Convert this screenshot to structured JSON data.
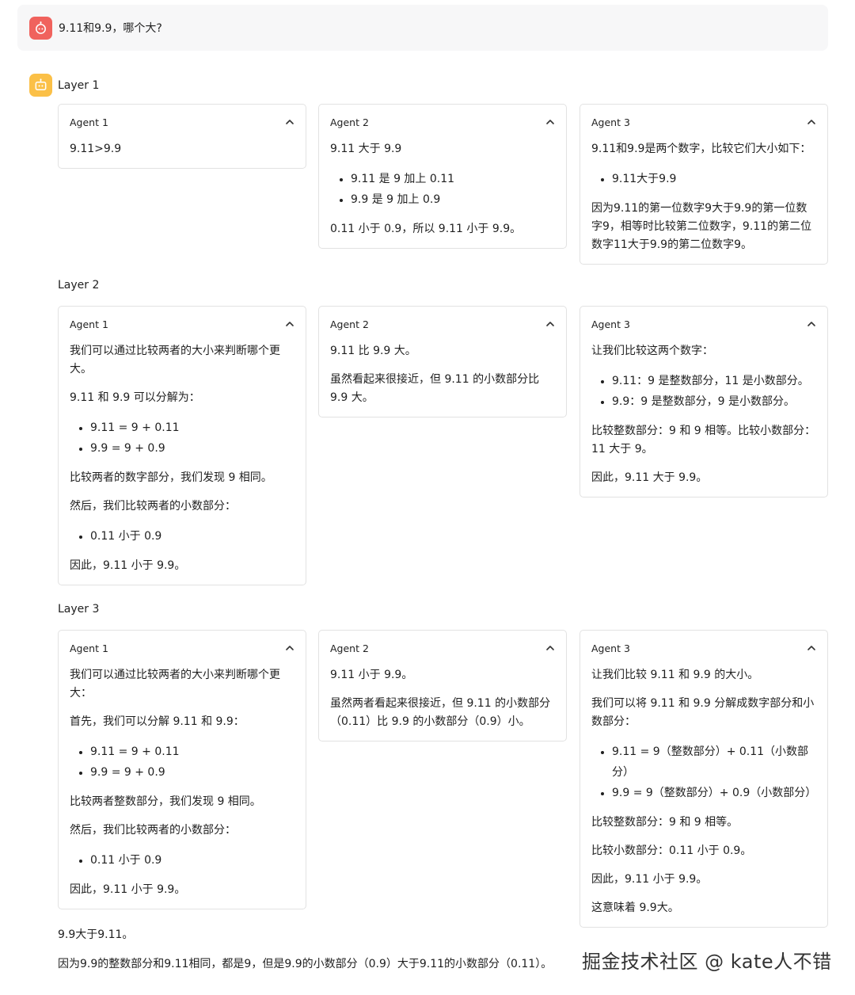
{
  "user_message": "9.11和9.9，哪个大?",
  "layers": [
    {
      "label": "Layer 1",
      "agents": [
        {
          "title": "Agent 1",
          "blocks": [
            {
              "type": "p",
              "text": "9.11>9.9"
            }
          ]
        },
        {
          "title": "Agent 2",
          "blocks": [
            {
              "type": "p",
              "text": "9.11 大于 9.9"
            },
            {
              "type": "ul",
              "items": [
                "9.11 是 9 加上 0.11",
                "9.9 是 9 加上 0.9"
              ]
            },
            {
              "type": "p",
              "text": "0.11 小于 0.9，所以 9.11 小于 9.9。"
            }
          ]
        },
        {
          "title": "Agent 3",
          "blocks": [
            {
              "type": "p",
              "text": "9.11和9.9是两个数字，比较它们大小如下："
            },
            {
              "type": "ul",
              "items": [
                "9.11大于9.9"
              ]
            },
            {
              "type": "p",
              "text": "因为9.11的第一位数字9大于9.9的第一位数字9，相等时比较第二位数字，9.11的第二位数字11大于9.9的第二位数字9。"
            }
          ]
        }
      ]
    },
    {
      "label": "Layer 2",
      "agents": [
        {
          "title": "Agent 1",
          "blocks": [
            {
              "type": "p",
              "text": "我们可以通过比较两者的大小来判断哪个更大。"
            },
            {
              "type": "p",
              "text": "9.11 和 9.9 可以分解为："
            },
            {
              "type": "ul",
              "items": [
                "9.11 = 9 + 0.11",
                "9.9 = 9 + 0.9"
              ]
            },
            {
              "type": "p",
              "text": "比较两者的数字部分，我们发现 9 相同。"
            },
            {
              "type": "p",
              "text": "然后，我们比较两者的小数部分："
            },
            {
              "type": "ul",
              "items": [
                "0.11 小于 0.9"
              ]
            },
            {
              "type": "p",
              "text": "因此，9.11 小于 9.9。"
            }
          ]
        },
        {
          "title": "Agent 2",
          "blocks": [
            {
              "type": "p",
              "text": "9.11 比 9.9 大。"
            },
            {
              "type": "p",
              "text": "虽然看起来很接近，但 9.11 的小数部分比 9.9 大。"
            }
          ]
        },
        {
          "title": "Agent 3",
          "blocks": [
            {
              "type": "p",
              "text": "让我们比较这两个数字："
            },
            {
              "type": "ul",
              "items": [
                "9.11：9 是整数部分，11 是小数部分。",
                "9.9：9 是整数部分，9 是小数部分。"
              ]
            },
            {
              "type": "p",
              "text": "比较整数部分：9 和 9 相等。比较小数部分：11 大于 9。"
            },
            {
              "type": "p",
              "text": "因此，9.11 大于 9.9。"
            }
          ]
        }
      ]
    },
    {
      "label": "Layer 3",
      "agents": [
        {
          "title": "Agent 1",
          "blocks": [
            {
              "type": "p",
              "text": "我们可以通过比较两者的大小来判断哪个更大："
            },
            {
              "type": "p",
              "text": "首先，我们可以分解 9.11 和 9.9："
            },
            {
              "type": "ul",
              "items": [
                "9.11 = 9 + 0.11",
                "9.9 = 9 + 0.9"
              ]
            },
            {
              "type": "p",
              "text": "比较两者整数部分，我们发现 9 相同。"
            },
            {
              "type": "p",
              "text": "然后，我们比较两者的小数部分："
            },
            {
              "type": "ul",
              "items": [
                "0.11 小于 0.9"
              ]
            },
            {
              "type": "p",
              "text": "因此，9.11 小于 9.9。"
            }
          ]
        },
        {
          "title": "Agent 2",
          "blocks": [
            {
              "type": "p",
              "text": "9.11 小于 9.9。"
            },
            {
              "type": "p",
              "text": "虽然两者看起来很接近，但 9.11 的小数部分（0.11）比 9.9 的小数部分（0.9）小。"
            }
          ]
        },
        {
          "title": "Agent 3",
          "blocks": [
            {
              "type": "p",
              "text": "让我们比较 9.11 和 9.9 的大小。"
            },
            {
              "type": "p",
              "text": "我们可以将 9.11 和 9.9 分解成数字部分和小数部分："
            },
            {
              "type": "ul",
              "items": [
                "9.11 = 9（整数部分）+ 0.11（小数部分）",
                "9.9 = 9（整数部分）+ 0.9（小数部分）"
              ]
            },
            {
              "type": "p",
              "text": "比较整数部分：9 和 9 相等。"
            },
            {
              "type": "p",
              "text": "比较小数部分：0.11 小于 0.9。"
            },
            {
              "type": "p",
              "text": "因此，9.11 小于 9.9。"
            },
            {
              "type": "p",
              "text": "这意味着 9.9大。"
            }
          ]
        }
      ]
    }
  ],
  "conclusion": {
    "line1": "9.9大于9.11。",
    "line2": "因为9.9的整数部分和9.11相同，都是9，但是9.9的小数部分（0.9）大于9.11的小数部分（0.11）。"
  },
  "watermark": "掘金技术社区 @ kate人不错",
  "icons": {
    "user_avatar": "robot-face-icon",
    "bot_avatar": "robot-icon",
    "collapse": "chevron-up-icon"
  },
  "colors": {
    "user_avatar": "#f0625d",
    "bot_avatar": "#fbc047",
    "user_bubble": "#f7f7f8",
    "card_border": "#e2e2e2"
  }
}
